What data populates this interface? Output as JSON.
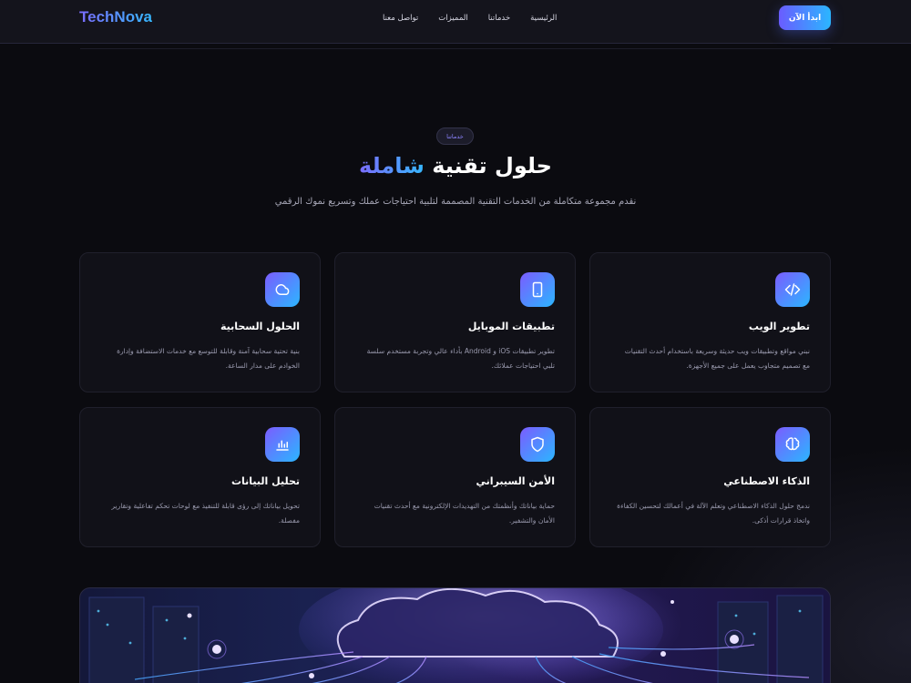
{
  "brand": {
    "logo": "TechNova"
  },
  "nav": {
    "cta_label": "ابدأ الآن",
    "links": [
      "الرئيسية",
      "خدماتنا",
      "المميزات",
      "تواصل معنا"
    ]
  },
  "hero": {
    "pill": "خدماتنا",
    "headline_main": "حلول تقنية",
    "headline_accent": "شاملة",
    "subtitle": "نقدم مجموعة متكاملة من الخدمات التقنية المصممة لتلبية احتياجات عملك وتسريع نموك الرقمي"
  },
  "services": [
    {
      "icon": "code-icon",
      "title": "تطوير الويب",
      "desc": "نبني مواقع وتطبيقات ويب حديثة وسريعة باستخدام أحدث التقنيات مع تصميم متجاوب يعمل على جميع الأجهزة."
    },
    {
      "icon": "smartphone-icon",
      "title": "تطبيقات الموبايل",
      "desc": "تطوير تطبيقات iOS و Android بأداء عالي وتجربة مستخدم سلسة تلبي احتياجات عملائك."
    },
    {
      "icon": "cloud-icon",
      "title": "الحلول السحابية",
      "desc": "بنية تحتية سحابية آمنة وقابلة للتوسع مع خدمات الاستضافة وإدارة الخوادم على مدار الساعة."
    },
    {
      "icon": "brain-icon",
      "title": "الذكاء الاصطناعي",
      "desc": "ندمج حلول الذكاء الاصطناعي وتعلم الآلة في أعمالك لتحسين الكفاءة واتخاذ قرارات أذكى."
    },
    {
      "icon": "shield-icon",
      "title": "الأمن السيبراني",
      "desc": "حماية بياناتك وأنظمتك من التهديدات الإلكترونية مع أحدث تقنيات الأمان والتشفير."
    },
    {
      "icon": "bar-chart-icon",
      "title": "تحليل البيانات",
      "desc": "تحويل بياناتك إلى رؤى قابلة للتنفيذ مع لوحات تحكم تفاعلية وتقارير مفصلة."
    }
  ],
  "colors": {
    "accent_start": "#7b5cff",
    "accent_end": "#2bb6ff",
    "background": "#0b0b10",
    "card": "#111118"
  }
}
